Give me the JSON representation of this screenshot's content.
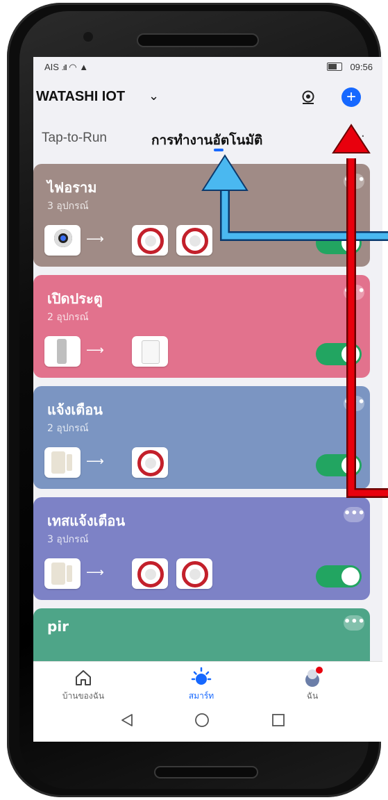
{
  "status_bar": {
    "carrier": "AIS",
    "time": "09:56"
  },
  "header": {
    "home_name": "WATASHI IOT",
    "dropdown_icon": "chevron-down-icon",
    "scan_icon": "eye-icon",
    "add_icon": "plus-icon"
  },
  "tabs": {
    "tap_to_run": "Tap-to-Run",
    "automation": "การทำงานอัตโนมัติ",
    "more": "·"
  },
  "cards": [
    {
      "title": "ไฟอราม",
      "subtitle": "3 อุปกรณ์",
      "bg": "#a08b86",
      "devices": [
        "camera",
        "siren",
        "siren"
      ],
      "enabled": true
    },
    {
      "title": "เปิดประตู",
      "subtitle": "2 อุปกรณ์",
      "bg": "#e2728d",
      "devices": [
        "lock",
        "panel"
      ],
      "enabled": true
    },
    {
      "title": "แจ้งเตือน",
      "subtitle": "2 อุปกรณ์",
      "bg": "#7b95c2",
      "devices": [
        "contact",
        "siren"
      ],
      "enabled": true
    },
    {
      "title": "เทสแจ้งเตือน",
      "subtitle": "3 อุปกรณ์",
      "bg": "#7d82c6",
      "devices": [
        "contact",
        "siren",
        "siren"
      ],
      "enabled": true
    },
    {
      "title": "pir",
      "subtitle": "",
      "bg": "#4ea588",
      "devices": [],
      "enabled": true
    }
  ],
  "more_dots": "•••",
  "arrow_glyph": "⟶",
  "bottom_nav": {
    "home": "บ้านของฉัน",
    "smart": "สมาร์ท",
    "me": "ฉัน"
  },
  "colors": {
    "accent": "#1668ff",
    "toggle_on": "#22a561",
    "annotation_red": "#e8000d",
    "annotation_blue": "#4ab8f0"
  }
}
